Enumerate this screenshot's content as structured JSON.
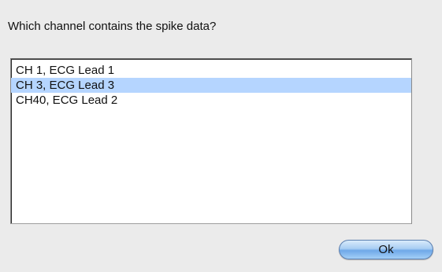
{
  "dialog": {
    "prompt": "Which channel contains the spike data?"
  },
  "channel_list": {
    "items": [
      {
        "label": "CH 1, ECG Lead 1",
        "selected": false
      },
      {
        "label": "CH 3, ECG Lead 3",
        "selected": true
      },
      {
        "label": "CH40, ECG Lead 2",
        "selected": false
      }
    ]
  },
  "buttons": {
    "ok_label": "Ok"
  },
  "colors": {
    "selection": "#b5d5ff",
    "dialog_background": "#ebebeb",
    "default_button": "#6fa8e8"
  }
}
